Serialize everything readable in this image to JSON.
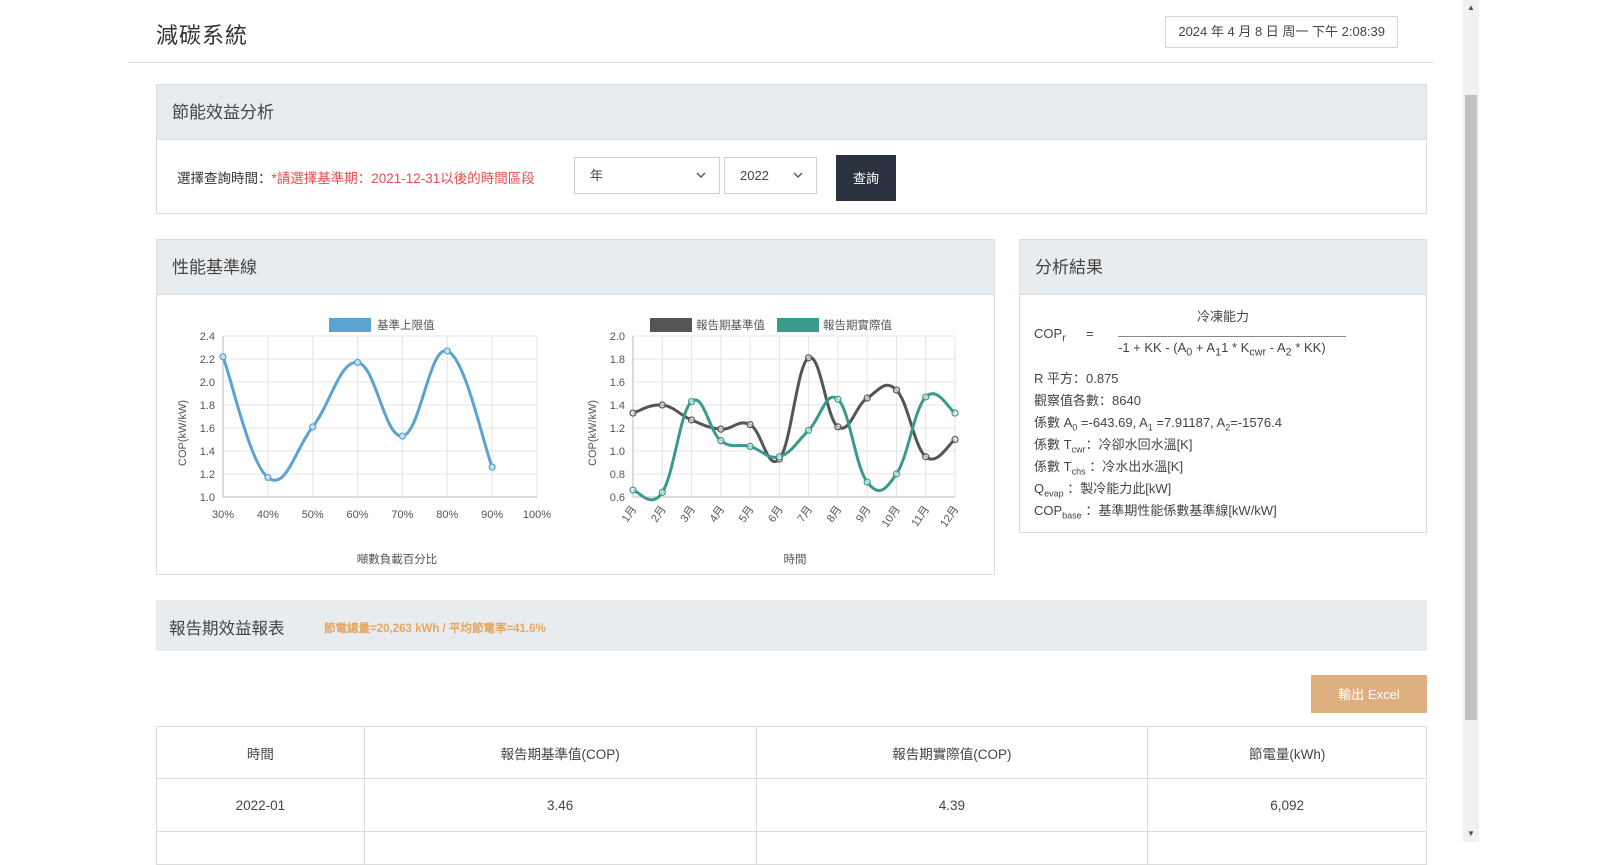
{
  "header": {
    "app_title": "減碳系統",
    "datetime": "2024 年 4 月 8 日 周一 下午 2:08:39"
  },
  "query_panel": {
    "title": "節能效益分析",
    "label": "選擇查詢時間：",
    "hint": "*請選擇基準期：2021-12-31以後的時間區段",
    "period_value": "年",
    "year_value": "2022",
    "query_button": "查詢"
  },
  "performance_panel": {
    "title": "性能基準線"
  },
  "chart_data": [
    {
      "type": "line",
      "legend": [
        "基準上限值"
      ],
      "series": [
        {
          "name": "基準上限值",
          "color": "#5ba3d0",
          "values": [
            2.22,
            1.17,
            1.61,
            2.17,
            1.53,
            2.27,
            1.26
          ]
        }
      ],
      "x": [
        "30%",
        "40%",
        "50%",
        "60%",
        "70%",
        "80%",
        "90%"
      ],
      "xticks": [
        "30%",
        "40%",
        "50%",
        "60%",
        "70%",
        "80%",
        "90%",
        "100%"
      ],
      "xlabel": "噸數負載百分比",
      "ylabel": "COP(kW/kW)",
      "ylim": [
        1.0,
        2.4
      ],
      "yticks": [
        "1.0",
        "1.2",
        "1.4",
        "1.6",
        "1.8",
        "2.0",
        "2.2",
        "2.4"
      ]
    },
    {
      "type": "line",
      "legend": [
        "報告期基準值",
        "報告期實際值"
      ],
      "categories": [
        "1月",
        "2月",
        "3月",
        "4月",
        "5月",
        "6月",
        "7月",
        "8月",
        "9月",
        "10月",
        "11月",
        "12月"
      ],
      "series": [
        {
          "name": "報告期基準值",
          "color": "#555555",
          "values": [
            1.33,
            1.4,
            1.27,
            1.19,
            1.23,
            0.93,
            1.81,
            1.21,
            1.46,
            1.53,
            0.95,
            1.1
          ]
        },
        {
          "name": "報告期實際值",
          "color": "#3a9a8e",
          "values": [
            0.66,
            0.64,
            1.43,
            1.09,
            1.04,
            0.95,
            1.18,
            1.45,
            0.73,
            0.8,
            1.47,
            1.33
          ]
        }
      ],
      "xlabel": "時間",
      "ylabel": "COP(kW/kW)",
      "ylim": [
        0.6,
        2.0
      ],
      "yticks": [
        "0.6",
        "0.8",
        "1.0",
        "1.2",
        "1.4",
        "1.6",
        "1.8",
        "2.0"
      ]
    }
  ],
  "result_panel": {
    "title": "分析結果",
    "formula_lhs": "COP",
    "formula_lhs_sub": "r",
    "formula_eq": "=",
    "formula_numerator": "冷凍能力",
    "formula_denominator": {
      "t1": "-1 + KK - (A",
      "s1": "0",
      "t2": " + A",
      "s2": "1",
      "t3": "1 * K",
      "s3": "cwr",
      "t4": " - A",
      "s4": "2",
      "t5": " * KK)"
    },
    "r_squared": "R 平方：0.875",
    "obs_count": "觀察值各數：8640",
    "coef": {
      "t1": "係數 A",
      "s1": "0",
      "t2": " =-643.69, A",
      "s2": "1",
      "t3": " =7.91187, A",
      "s3": "2",
      "t4": "=-1576.4"
    },
    "tcwr": {
      "t1": "係數 T",
      "s1": "cwr",
      "t2": "：冷卻水回水溫[K]"
    },
    "tchs": {
      "t1": "係數 T",
      "s1": "chs",
      "t2": " ：冷水出水溫[K]"
    },
    "qevap": {
      "t1": "Q",
      "s1": "evap",
      "t2": " ：製冷能力此[kW]"
    },
    "copbase": {
      "t1": "COP",
      "s1": "base",
      "t2": " ：基準期性能係數基準線[kW/kW]"
    }
  },
  "report": {
    "title": "報告期效益報表",
    "summary": "節電總量=20,263 kWh / 平均節電率=41.6%",
    "export_button": "輸出 Excel",
    "columns": [
      "時間",
      "報告期基準值(COP)",
      "報告期實際值(COP)",
      "節電量(kWh)"
    ],
    "rows": [
      [
        "2022-01",
        "3.46",
        "4.39",
        "6,092"
      ]
    ]
  }
}
